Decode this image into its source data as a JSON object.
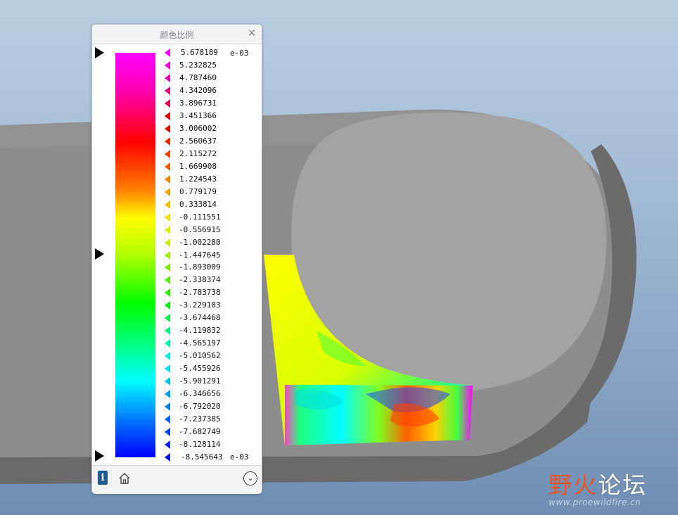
{
  "panel": {
    "title": "颜色比例",
    "close_label": "×",
    "exponent_top": "e-03",
    "exponent_bottom": "e-03",
    "info_label": "i",
    "expand_label": "⌄"
  },
  "scale": {
    "values": [
      "5.678189",
      "5.232825",
      "4.787460",
      "4.342096",
      "3.896731",
      "3.451366",
      "3.006002",
      "2.560637",
      "2.115272",
      "1.669908",
      "1.224543",
      "0.779179",
      "0.333814",
      "-0.111551",
      "-0.556915",
      "-1.002280",
      "-1.447645",
      "-1.893009",
      "-2.338374",
      "-2.783738",
      "-3.229103",
      "-3.674468",
      "-4.119832",
      "-4.565197",
      "-5.010562",
      "-5.455926",
      "-5.901291",
      "-6.346656",
      "-6.792020",
      "-7.237385",
      "-7.682749",
      "-8.128114",
      "-8.545643"
    ],
    "marker_colors": [
      "#ff00ff",
      "#f000d8",
      "#e800b0",
      "#e0007a",
      "#d8003c",
      "#d80000",
      "#e01000",
      "#e82800",
      "#f04000",
      "#f06000",
      "#f08000",
      "#f0a000",
      "#f0c000",
      "#f0e000",
      "#d8f000",
      "#b8f000",
      "#98f000",
      "#78f000",
      "#50f000",
      "#20f000",
      "#00f000",
      "#00f040",
      "#00f080",
      "#00f0b0",
      "#00f0e0",
      "#00e0f0",
      "#00c0f0",
      "#00a0f0",
      "#0080f0",
      "#0060f0",
      "#0040f0",
      "#0020f0",
      "#0000f0"
    ]
  },
  "watermark": {
    "cn_part1": "野火",
    "cn_part2": "论坛",
    "url": "www.proewildfire.cn"
  },
  "icons": [
    "close-icon",
    "info-icon",
    "home-icon",
    "chevron-down-icon"
  ]
}
